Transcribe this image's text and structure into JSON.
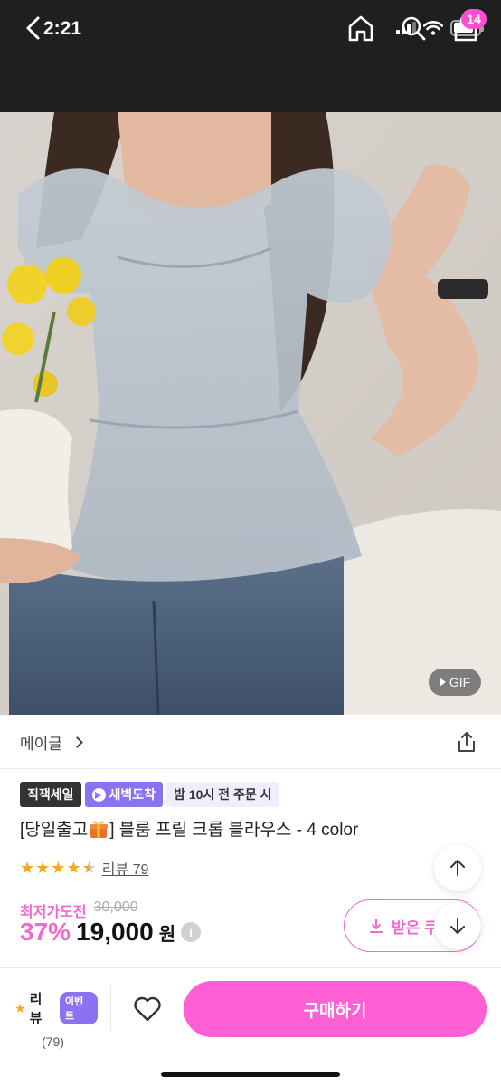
{
  "status_bar": {
    "time": "2:21"
  },
  "nav": {
    "cart_count": "14",
    "icons": [
      "back-arrow-icon",
      "home-icon",
      "search-icon",
      "shopping-bag-icon"
    ]
  },
  "product_image": {
    "gif_label": "GIF"
  },
  "shop": {
    "name": "메이글"
  },
  "tags": {
    "direct_sale": "직잭세일",
    "dawn_delivery": "새벽도착",
    "order_deadline": "밤 10시 전 주문 시"
  },
  "product": {
    "title_prefix": "[당일출고",
    "title_suffix": "] 블룸 프릴 크롭 블라우스 - 4 color",
    "rating": 4.5,
    "review_link": "리뷰 79"
  },
  "price": {
    "lowest_label": "최저가도전",
    "original": "30,000",
    "discount": "37%",
    "sale": "19,000",
    "currency": "원",
    "info": "i"
  },
  "coupon": {
    "label": "받은 쿠폰"
  },
  "bottom_bar": {
    "review_label": "리뷰",
    "event_label": "이벤트",
    "review_count": "(79)",
    "buy_label": "구매하기"
  },
  "colors": {
    "accent_pink": "#ff5fd4",
    "price_pink": "#f06ad0",
    "purple": "#8a72f2",
    "star": "#f5a623",
    "header": "#1f1f1f"
  }
}
